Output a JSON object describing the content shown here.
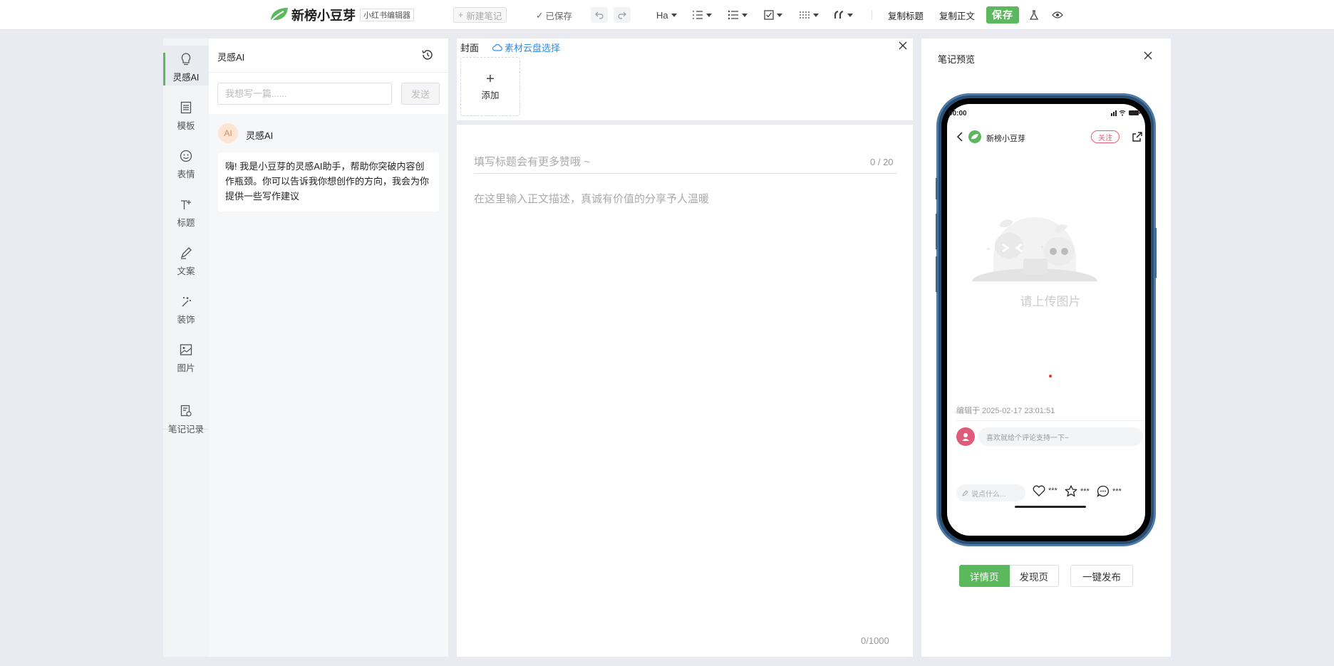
{
  "header": {
    "app_title": "新榜小豆芽",
    "app_badge": "小红书编辑器",
    "new_note_label": "新建笔记",
    "saved_label": "已保存",
    "heading_label": "Ha",
    "copy_title_label": "复制标题",
    "copy_body_label": "复制正文",
    "save_label": "保存"
  },
  "sidebar": {
    "items": [
      {
        "label": "灵感AI",
        "icon": "bulb-icon",
        "active": true
      },
      {
        "label": "模板",
        "icon": "template-icon"
      },
      {
        "label": "表情",
        "icon": "emoji-icon"
      },
      {
        "label": "标题",
        "icon": "title-icon"
      },
      {
        "label": "文案",
        "icon": "pen-icon"
      },
      {
        "label": "装饰",
        "icon": "magic-wand-icon"
      },
      {
        "label": "图片",
        "icon": "image-icon"
      },
      {
        "label": "笔记记录",
        "icon": "note-history-icon"
      }
    ]
  },
  "ai_panel": {
    "title": "灵感AI",
    "input_placeholder": "我想写一篇......",
    "send_label": "发送",
    "avatar_text": "AI",
    "assistant_name": "灵感AI",
    "greeting": "嗨! 我是小豆芽的灵感AI助手，帮助你突破内容创作瓶颈。你可以告诉我你想创作的方向，我会为你提供一些写作建议"
  },
  "editor": {
    "cover_label": "封面",
    "cloud_label": "素材云盘选择",
    "add_label": "添加",
    "title_placeholder": "填写标题会有更多赞哦 ~",
    "title_count": "0 / 20",
    "body_placeholder": "在这里输入正文描述，真诚有价值的分享予人温暖",
    "body_count": "0/1000"
  },
  "preview": {
    "title": "笔记预览",
    "status_time": "00:00",
    "account_name": "新榜小豆芽",
    "follow_label": "关注",
    "upload_hint": "请上传图片",
    "edited_time": "编辑于 2025-02-17 23:01:51",
    "comment_placeholder": "喜欢就给个评论支持一下~",
    "say_placeholder": "说点什么...",
    "like_count": "***",
    "collect_count": "***",
    "comment_count": "***",
    "tabs": [
      "详情页",
      "发现页"
    ],
    "active_tab": "详情页",
    "publish_label": "一键发布"
  },
  "colors": {
    "accent": "#5bb85c",
    "link": "#2d8cf0",
    "follow": "#f05a6e"
  }
}
